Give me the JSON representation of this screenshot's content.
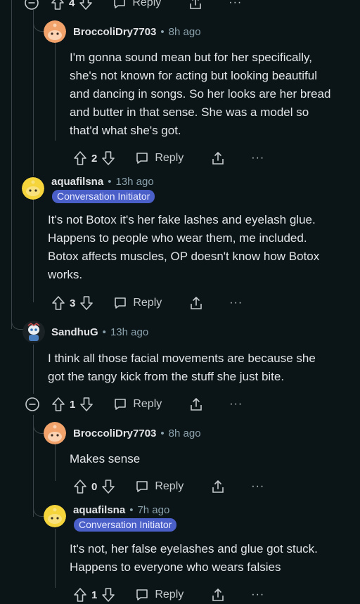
{
  "comments": [
    {
      "top_actions": {
        "votes": "4",
        "reply_label": "Reply",
        "more_label": "···"
      }
    },
    {
      "username": "BroccoliDry7703",
      "sep": "•",
      "time": "8h ago",
      "lines": [
        "I'm gonna sound mean but for her specifically,",
        "she's not known for acting but looking beautiful",
        "and dancing in songs. So her looks are her bread",
        "and butter in that sense. She was a model so",
        "that'd what she's got."
      ],
      "votes": "2",
      "reply_label": "Reply",
      "more_label": "···"
    },
    {
      "username": "aquafilsna",
      "sep": "•",
      "time": "13h ago",
      "badge": "Conversation Initiator",
      "lines": [
        "It's not Botox it's her fake lashes and eyelash glue.",
        "Happens to people who wear them, me included.",
        "Botox affects muscles, OP doesn't know how Botox",
        "works."
      ],
      "votes": "3",
      "reply_label": "Reply",
      "more_label": "···"
    },
    {
      "username": "SandhuG",
      "sep": "•",
      "time": "13h ago",
      "lines": [
        "I think all those facial movements are because she",
        "got the tangy kick from the stuff she just bite."
      ],
      "votes": "1",
      "reply_label": "Reply",
      "more_label": "···"
    },
    {
      "username": "BroccoliDry7703",
      "sep": "•",
      "time": "8h ago",
      "lines": [
        "Makes sense"
      ],
      "votes": "0",
      "reply_label": "Reply",
      "more_label": "···"
    },
    {
      "username": "aquafilsna",
      "sep": "•",
      "time": "7h ago",
      "badge": "Conversation Initiator",
      "lines": [
        "It's not, her false eyelashes and glue got stuck.",
        "Happens to everyone who wears falsies"
      ],
      "votes": "1",
      "reply_label": "Reply",
      "more_label": "···"
    }
  ],
  "icons": {
    "collapse": "collapse-thread-icon",
    "upvote": "upvote-arrow-icon",
    "downvote": "downvote-arrow-icon",
    "reply": "reply-bubble-icon",
    "share": "share-icon",
    "more": "more-dots-icon",
    "avatar_orange": "orange-snoo-avatar",
    "avatar_yellow": "yellow-snoo-avatar",
    "avatar_custom": "custom-snoo-avatar"
  },
  "colors": {
    "background": "#0b1416",
    "badge": "#4b5fc9",
    "thread_line": "#3a4448",
    "meta_text": "#8ba2ad"
  }
}
